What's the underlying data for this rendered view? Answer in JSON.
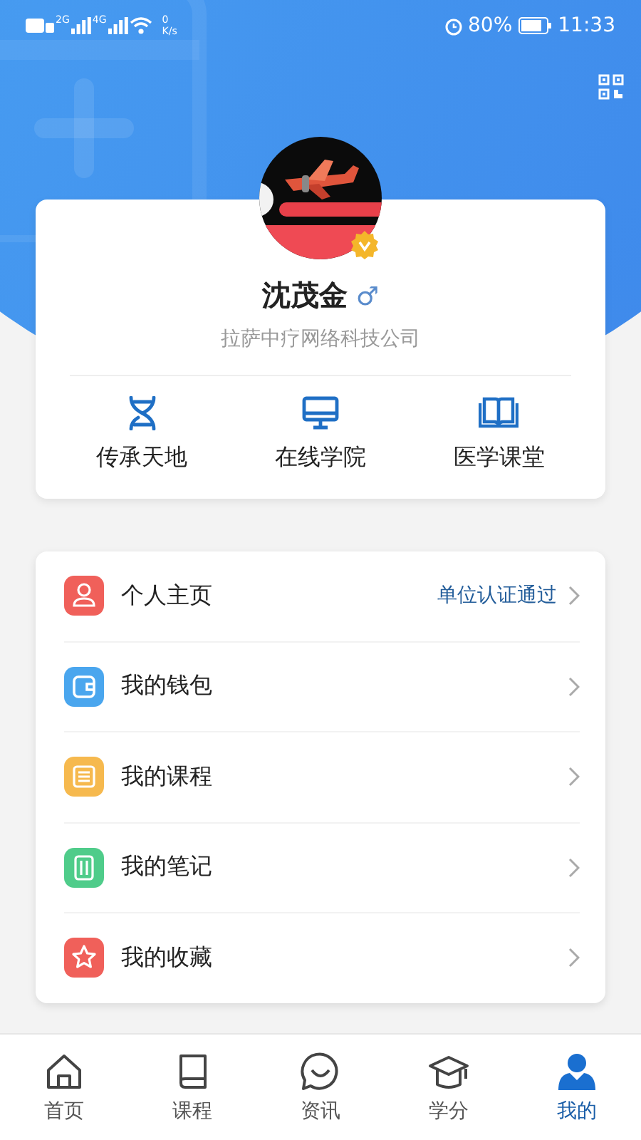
{
  "status_bar": {
    "left": [
      "2G",
      "4G"
    ],
    "speed_value": "0",
    "speed_unit": "K/s",
    "battery": "80%",
    "time": "11:33"
  },
  "profile": {
    "name": "沈茂金",
    "gender": "♂",
    "verified": true,
    "company": "拉萨中疗网络科技公司"
  },
  "shortcuts": [
    {
      "label": "传承天地",
      "kind": "dna"
    },
    {
      "label": "在线学院",
      "kind": "monitor"
    },
    {
      "label": "医学课堂",
      "kind": "book"
    }
  ],
  "menu": [
    {
      "label": "个人主页",
      "kind": "person",
      "color": "#f0605a",
      "status": "单位认证通过"
    },
    {
      "label": "我的钱包",
      "kind": "wallet",
      "color": "#4aa6ee"
    },
    {
      "label": "我的课程",
      "kind": "course",
      "color": "#f6b94e"
    },
    {
      "label": "我的笔记",
      "kind": "note",
      "color": "#4fcc8a"
    },
    {
      "label": "我的收藏",
      "kind": "star",
      "color": "#f0605a"
    }
  ],
  "tabs": [
    {
      "label": "首页",
      "kind": "home",
      "selected": false
    },
    {
      "label": "课程",
      "kind": "book",
      "selected": false
    },
    {
      "label": "资讯",
      "kind": "chat",
      "selected": false
    },
    {
      "label": "学分",
      "kind": "cap",
      "selected": false
    },
    {
      "label": "我的",
      "kind": "user",
      "selected": true
    }
  ]
}
